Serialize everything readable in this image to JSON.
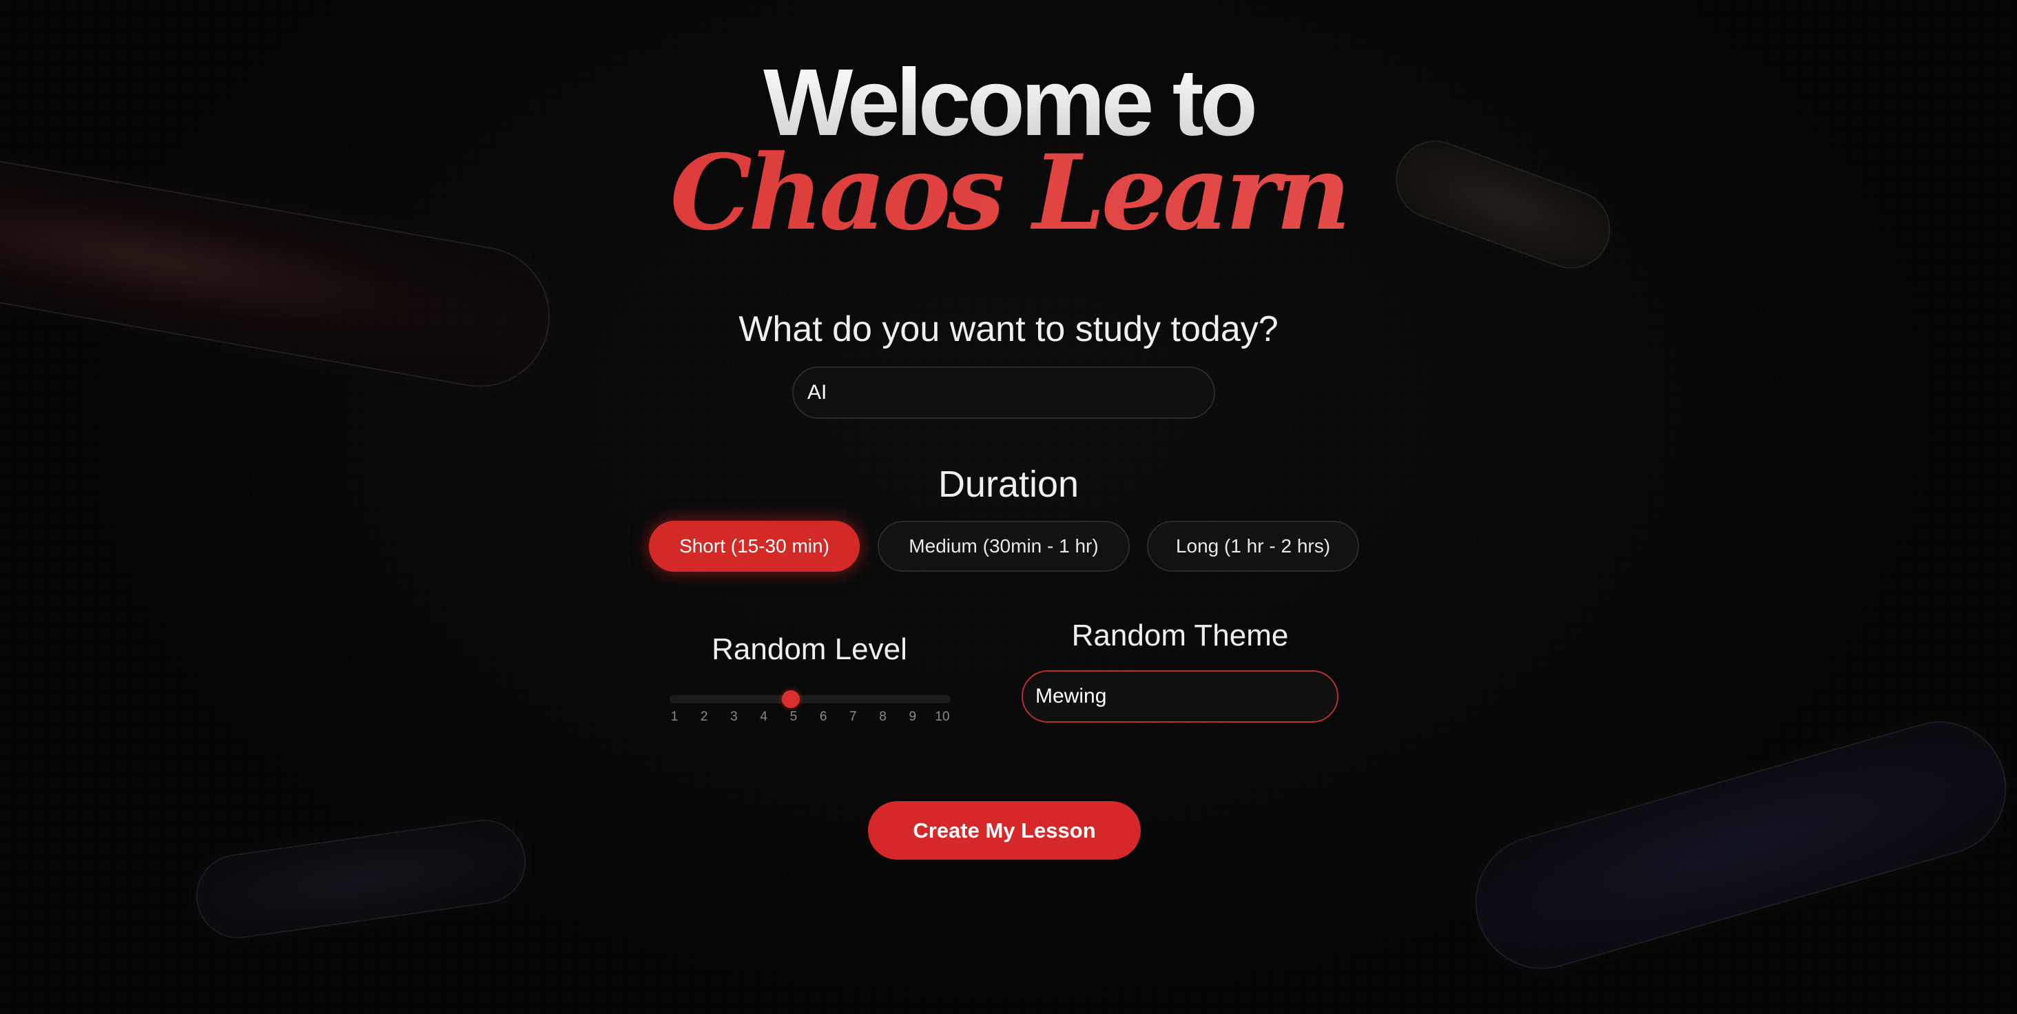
{
  "header": {
    "title_line_1": "Welcome to",
    "title_line_2": "Chaos Learn"
  },
  "study": {
    "question": "What do you want to study today?",
    "input_value": "AI",
    "input_placeholder": ""
  },
  "duration": {
    "label": "Duration",
    "options": [
      {
        "label": "Short (15-30 min)",
        "selected": true
      },
      {
        "label": "Medium (30min - 1 hr)",
        "selected": false
      },
      {
        "label": "Long (1 hr - 2 hrs)",
        "selected": false
      }
    ]
  },
  "random_level": {
    "label": "Random Level",
    "value": 5,
    "min": 1,
    "max": 10,
    "ticks": [
      "1",
      "2",
      "3",
      "4",
      "5",
      "6",
      "7",
      "8",
      "9",
      "10"
    ]
  },
  "random_theme": {
    "label": "Random Theme",
    "input_value": "Mewing"
  },
  "actions": {
    "create_label": "Create My Lesson"
  },
  "colors": {
    "accent": "#d62828",
    "background": "#070707"
  }
}
